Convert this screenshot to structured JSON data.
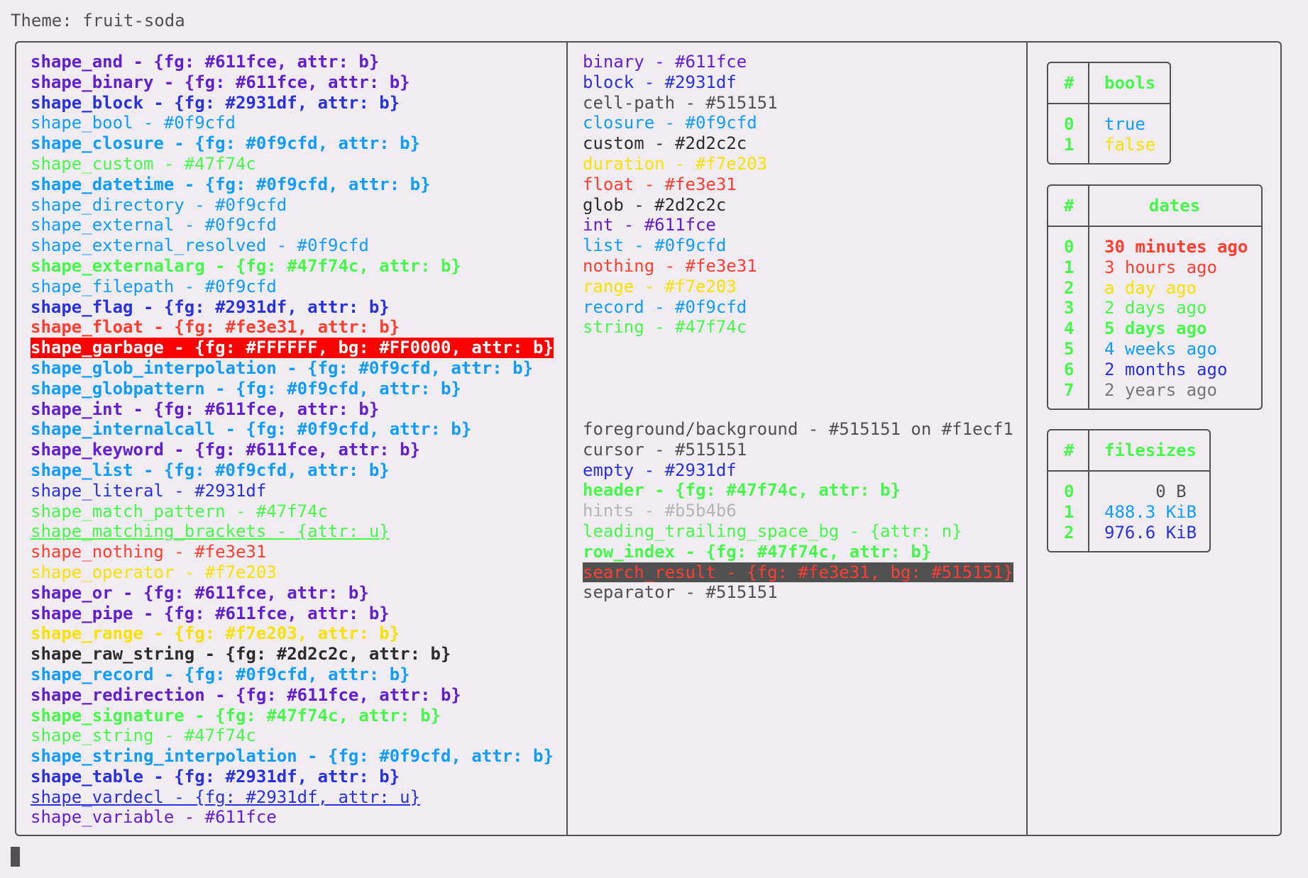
{
  "title": "Theme: fruit-soda",
  "shapes": [
    {
      "text": "shape_and - {fg: #611fce, attr: b}",
      "color": "#611fce",
      "bold": true
    },
    {
      "text": "shape_binary - {fg: #611fce, attr: b}",
      "color": "#611fce",
      "bold": true
    },
    {
      "text": "shape_block - {fg: #2931df, attr: b}",
      "color": "#2931df",
      "bold": true
    },
    {
      "text": "shape_bool - #0f9cfd",
      "color": "#0f9cfd"
    },
    {
      "text": "shape_closure - {fg: #0f9cfd, attr: b}",
      "color": "#0f9cfd",
      "bold": true
    },
    {
      "text": "shape_custom - #47f74c",
      "color": "#47f74c"
    },
    {
      "text": "shape_datetime - {fg: #0f9cfd, attr: b}",
      "color": "#0f9cfd",
      "bold": true
    },
    {
      "text": "shape_directory - #0f9cfd",
      "color": "#0f9cfd"
    },
    {
      "text": "shape_external - #0f9cfd",
      "color": "#0f9cfd"
    },
    {
      "text": "shape_external_resolved - #0f9cfd",
      "color": "#0f9cfd"
    },
    {
      "text": "shape_externalarg - {fg: #47f74c, attr: b}",
      "color": "#47f74c",
      "bold": true
    },
    {
      "text": "shape_filepath - #0f9cfd",
      "color": "#0f9cfd"
    },
    {
      "text": "shape_flag - {fg: #2931df, attr: b}",
      "color": "#2931df",
      "bold": true
    },
    {
      "text": "shape_float - {fg: #fe3e31, attr: b}",
      "color": "#fe3e31",
      "bold": true
    },
    {
      "text": "shape_garbage - {fg: #FFFFFF, bg: #FF0000, attr: b}",
      "color": "#FFFFFF",
      "bg": "#FF0000",
      "bold": true
    },
    {
      "text": "shape_glob_interpolation - {fg: #0f9cfd, attr: b}",
      "color": "#0f9cfd",
      "bold": true
    },
    {
      "text": "shape_globpattern - {fg: #0f9cfd, attr: b}",
      "color": "#0f9cfd",
      "bold": true
    },
    {
      "text": "shape_int - {fg: #611fce, attr: b}",
      "color": "#611fce",
      "bold": true
    },
    {
      "text": "shape_internalcall - {fg: #0f9cfd, attr: b}",
      "color": "#0f9cfd",
      "bold": true
    },
    {
      "text": "shape_keyword - {fg: #611fce, attr: b}",
      "color": "#611fce",
      "bold": true
    },
    {
      "text": "shape_list - {fg: #0f9cfd, attr: b}",
      "color": "#0f9cfd",
      "bold": true
    },
    {
      "text": "shape_literal - #2931df",
      "color": "#2931df"
    },
    {
      "text": "shape_match_pattern - #47f74c",
      "color": "#47f74c"
    },
    {
      "text": "shape_matching_brackets - {attr: u}",
      "color": "#47f74c",
      "underline": true
    },
    {
      "text": "shape_nothing - #fe3e31",
      "color": "#fe3e31"
    },
    {
      "text": "shape_operator - #f7e203",
      "color": "#f7e203"
    },
    {
      "text": "shape_or - {fg: #611fce, attr: b}",
      "color": "#611fce",
      "bold": true
    },
    {
      "text": "shape_pipe - {fg: #611fce, attr: b}",
      "color": "#611fce",
      "bold": true
    },
    {
      "text": "shape_range - {fg: #f7e203, attr: b}",
      "color": "#f7e203",
      "bold": true
    },
    {
      "text": "shape_raw_string - {fg: #2d2c2c, attr: b}",
      "color": "#2d2c2c",
      "bold": true
    },
    {
      "text": "shape_record - {fg: #0f9cfd, attr: b}",
      "color": "#0f9cfd",
      "bold": true
    },
    {
      "text": "shape_redirection - {fg: #611fce, attr: b}",
      "color": "#611fce",
      "bold": true
    },
    {
      "text": "shape_signature - {fg: #47f74c, attr: b}",
      "color": "#47f74c",
      "bold": true
    },
    {
      "text": "shape_string - #47f74c",
      "color": "#47f74c"
    },
    {
      "text": "shape_string_interpolation - {fg: #0f9cfd, attr: b}",
      "color": "#0f9cfd",
      "bold": true
    },
    {
      "text": "shape_table - {fg: #2931df, attr: b}",
      "color": "#2931df",
      "bold": true
    },
    {
      "text": "shape_vardecl - {fg: #2931df, attr: u}",
      "color": "#2931df",
      "underline": true
    },
    {
      "text": "shape_variable - #611fce",
      "color": "#611fce"
    }
  ],
  "types": [
    {
      "text": "binary - #611fce",
      "color": "#611fce"
    },
    {
      "text": "block - #2931df",
      "color": "#2931df"
    },
    {
      "text": "cell-path - #515151",
      "color": "#515151"
    },
    {
      "text": "closure - #0f9cfd",
      "color": "#0f9cfd"
    },
    {
      "text": "custom - #2d2c2c",
      "color": "#2d2c2c"
    },
    {
      "text": "duration - #f7e203",
      "color": "#f7e203"
    },
    {
      "text": "float - #fe3e31",
      "color": "#fe3e31"
    },
    {
      "text": "glob - #2d2c2c",
      "color": "#2d2c2c"
    },
    {
      "text": "int - #611fce",
      "color": "#611fce"
    },
    {
      "text": "list - #0f9cfd",
      "color": "#0f9cfd"
    },
    {
      "text": "nothing - #fe3e31",
      "color": "#fe3e31"
    },
    {
      "text": "range - #f7e203",
      "color": "#f7e203"
    },
    {
      "text": "record - #0f9cfd",
      "color": "#0f9cfd"
    },
    {
      "text": "string - #47f74c",
      "color": "#47f74c"
    }
  ],
  "ui": [
    {
      "text": "foreground/background - #515151 on #f1ecf1",
      "color": "#515151"
    },
    {
      "text": "cursor - #515151",
      "color": "#515151"
    },
    {
      "text": "empty - #2931df",
      "color": "#2931df"
    },
    {
      "text": "header - {fg: #47f74c, attr: b}",
      "color": "#47f74c",
      "bold": true
    },
    {
      "text": "hints - #b5b4b6",
      "color": "#b5b4b6"
    },
    {
      "text": "leading_trailing_space_bg - {attr: n}",
      "color": "#47f74c"
    },
    {
      "text": "row_index - {fg: #47f74c, attr: b}",
      "color": "#47f74c",
      "bold": true
    },
    {
      "text": "search_result - {fg: #fe3e31, bg: #515151}",
      "color": "#fe3e31",
      "bg": "#515151"
    },
    {
      "text": "separator - #515151",
      "color": "#515151"
    }
  ],
  "bools": {
    "index_header": "#",
    "header": "bools",
    "rows": [
      {
        "idx": "0",
        "value": "true",
        "color": "#0f9cfd"
      },
      {
        "idx": "1",
        "value": "false",
        "color": "#f7e203"
      }
    ]
  },
  "dates": {
    "index_header": "#",
    "header": "dates",
    "rows": [
      {
        "idx": "0",
        "value": "30 minutes ago",
        "color": "#fe3e31",
        "bold": true
      },
      {
        "idx": "1",
        "value": "3 hours ago",
        "color": "#fe3e31"
      },
      {
        "idx": "2",
        "value": "a day ago",
        "color": "#f7e203"
      },
      {
        "idx": "3",
        "value": "2 days ago",
        "color": "#47f74c"
      },
      {
        "idx": "4",
        "value": "5 days ago",
        "color": "#47f74c",
        "bold": true
      },
      {
        "idx": "5",
        "value": "4 weeks ago",
        "color": "#0f9cfd"
      },
      {
        "idx": "6",
        "value": "2 months ago",
        "color": "#2931df"
      },
      {
        "idx": "7",
        "value": "2 years ago",
        "color": "#777777"
      }
    ]
  },
  "filesizes": {
    "index_header": "#",
    "header": "filesizes",
    "rows": [
      {
        "idx": "0",
        "value": "     0 B",
        "color": "#515151"
      },
      {
        "idx": "1",
        "value": "488.3 KiB",
        "color": "#0f9cfd"
      },
      {
        "idx": "2",
        "value": "976.6 KiB",
        "color": "#2931df"
      }
    ]
  }
}
